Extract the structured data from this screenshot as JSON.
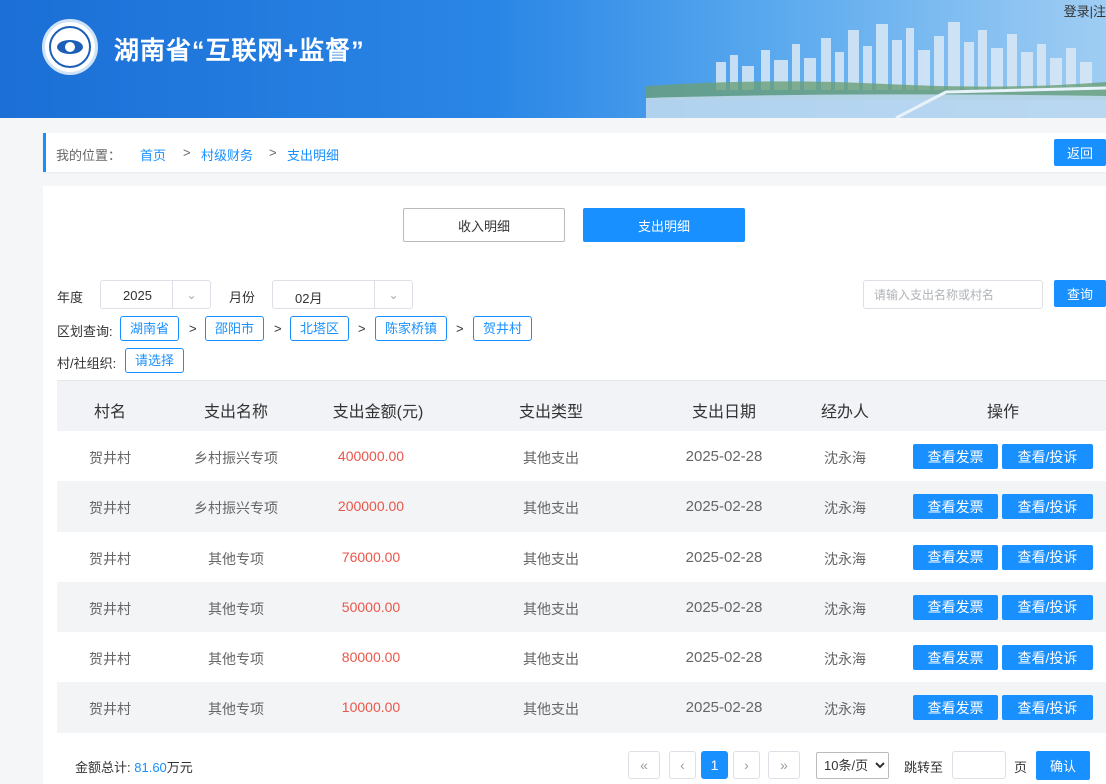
{
  "header": {
    "title": "湖南省“互联网+监督”",
    "login": "登录|注"
  },
  "breadcrumb": {
    "label": "我的位置：",
    "items": [
      "首页",
      "村级财务",
      "支出明细"
    ],
    "separator": ">",
    "back_label": "返回"
  },
  "tabs": {
    "income": "收入明细",
    "expense": "支出明细"
  },
  "filters": {
    "year_label": "年度",
    "year_value": "2025",
    "month_label": "月份",
    "month_value": "02月",
    "search_placeholder": "请输入支出名称或村名",
    "query_label": "查询",
    "region_label": "区划查询:",
    "regions": [
      "湖南省",
      "邵阳市",
      "北塔区",
      "陈家桥镇",
      "贺井村"
    ],
    "org_label": "村/社组织:",
    "org_select": "请选择"
  },
  "table": {
    "columns": [
      "村名",
      "支出名称",
      "支出金额(元)",
      "支出类型",
      "支出日期",
      "经办人",
      "操作"
    ],
    "view_invoice": "查看发票",
    "view_complain": "查看/投诉",
    "rows": [
      {
        "village": "贺井村",
        "name": "乡村振兴专项",
        "amount": "400000.00",
        "type": "其他支出",
        "date": "2025-02-28",
        "handler": "沈永海"
      },
      {
        "village": "贺井村",
        "name": "乡村振兴专项",
        "amount": "200000.00",
        "type": "其他支出",
        "date": "2025-02-28",
        "handler": "沈永海"
      },
      {
        "village": "贺井村",
        "name": "其他专项",
        "amount": "76000.00",
        "type": "其他支出",
        "date": "2025-02-28",
        "handler": "沈永海"
      },
      {
        "village": "贺井村",
        "name": "其他专项",
        "amount": "50000.00",
        "type": "其他支出",
        "date": "2025-02-28",
        "handler": "沈永海"
      },
      {
        "village": "贺井村",
        "name": "其他专项",
        "amount": "80000.00",
        "type": "其他支出",
        "date": "2025-02-28",
        "handler": "沈永海"
      },
      {
        "village": "贺井村",
        "name": "其他专项",
        "amount": "10000.00",
        "type": "其他支出",
        "date": "2025-02-28",
        "handler": "沈永海"
      }
    ]
  },
  "footer": {
    "total_label": "金额总计:",
    "total_value": "81.60",
    "total_unit": "万元",
    "first_glyph": "«",
    "prev_glyph": "‹",
    "current_page": "1",
    "next_glyph": "›",
    "last_glyph": "»",
    "page_size": "10条/页",
    "jump_label": "跳转至",
    "page_unit": "页",
    "confirm_label": "确认"
  }
}
